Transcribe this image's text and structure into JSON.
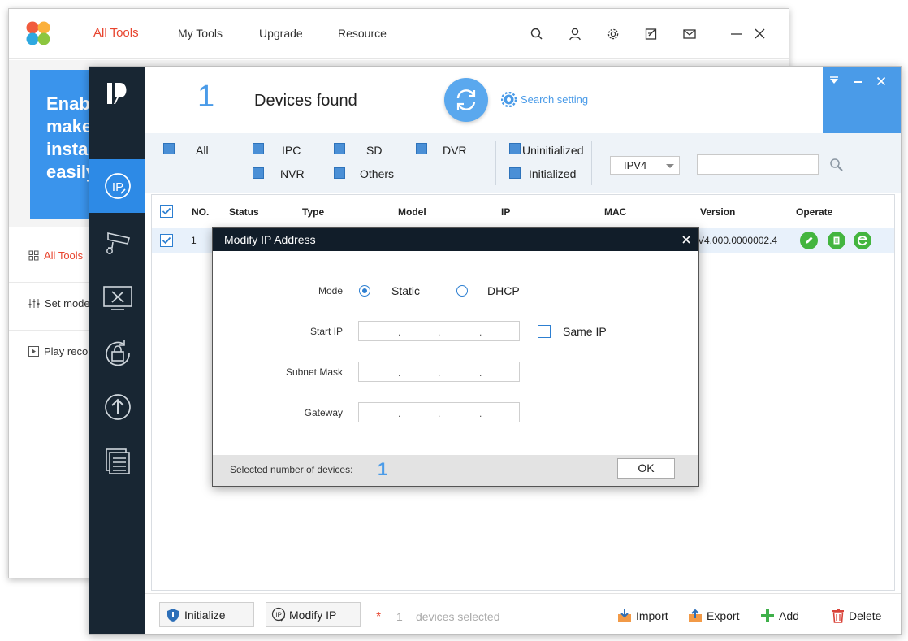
{
  "back_window": {
    "tabs": [
      "All Tools",
      "My Tools",
      "Upgrade",
      "Resource"
    ],
    "promo_lines": [
      "Enab",
      "make",
      "insta",
      "easily"
    ],
    "nav": [
      "All Tools",
      "Set mode",
      "Play reco"
    ]
  },
  "ip_tool": {
    "device_count": "1",
    "found_label": "Devices found",
    "search_setting": "Search setting",
    "filters": {
      "all": "All",
      "ipc": "IPC",
      "sd": "SD",
      "dvr": "DVR",
      "nvr": "NVR",
      "others": "Others",
      "uninitialized": "Uninitialized",
      "initialized": "Initialized"
    },
    "ip_version": "IPV4",
    "search_value": "",
    "table": {
      "headers": [
        "NO.",
        "Status",
        "Type",
        "Model",
        "IP",
        "MAC",
        "Version",
        "Operate"
      ],
      "rows": [
        {
          "no": "1",
          "version": "V4.000.0000002.4"
        }
      ]
    },
    "footer": {
      "initialize": "Initialize",
      "modify_ip": "Modify IP",
      "asterisk": "*",
      "selected_count": "1",
      "selected_text": "devices selected",
      "import": "Import",
      "export": "Export",
      "add": "Add",
      "delete": "Delete"
    }
  },
  "modal": {
    "title": "Modify IP Address",
    "mode_label": "Mode",
    "static_label": "Static",
    "dhcp_label": "DHCP",
    "selected_mode": "Static",
    "start_ip_label": "Start IP",
    "same_ip_label": "Same IP",
    "subnet_label": "Subnet Mask",
    "gateway_label": "Gateway",
    "ip_dot": ".",
    "selected_devices_label": "Selected number of devices:",
    "selected_devices_value": "1",
    "ok_label": "OK"
  },
  "colors": {
    "accent_blue": "#4a9be8",
    "sidebar_dark": "#182633",
    "active_tab_red": "#e8452f",
    "op_green": "#44b53f"
  },
  "icons": [
    "search-icon",
    "user-icon",
    "gear-icon",
    "edit-icon",
    "mail-icon",
    "minimize-icon",
    "close-icon",
    "refresh-icon",
    "shield-icon",
    "import-icon",
    "export-icon",
    "add-icon",
    "delete-icon"
  ]
}
